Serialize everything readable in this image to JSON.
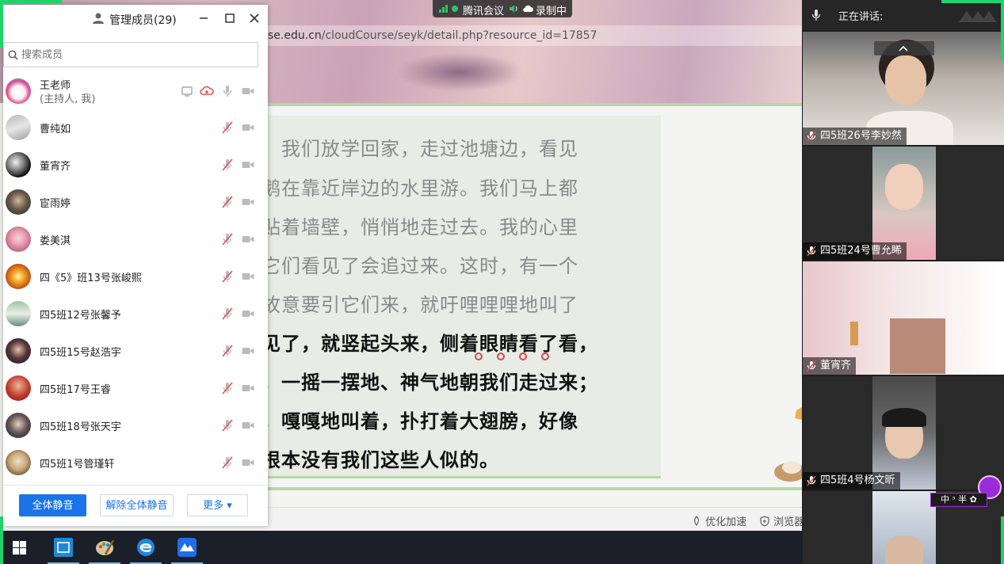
{
  "screen": {
    "url_prefix": "se.edu.cn",
    "url_rest": "/cloudCourse/seyk/detail.php?resource_id=17857",
    "text_lines_gray": [
      "，我们放学回家，走过池塘边，看见",
      "鹅在靠近岸边的水里游。我们马上都",
      "贴着墙壁，悄悄地走过去。我的心里",
      "它们看见了会追过来。这时，有一个",
      "故意要引它们来，就吁哩哩哩地叫了"
    ],
    "text_lines_dark": [
      "见了，就竖起头来，侧着眼睛看了看，",
      "，一摇一摆地、神气地朝我们走过来；",
      "，嘎嘎地叫着，扑打着大翅膀，好像",
      "根本没有我们这些人似的。"
    ],
    "bottom_items": [
      "优化加速",
      "浏览器"
    ]
  },
  "meeting_bar": {
    "app_name": "腾讯会议",
    "recording": "录制中"
  },
  "panel": {
    "title": "管理成员(29)",
    "search_placeholder": "搜索成员",
    "host": {
      "name": "王老师",
      "role": "(主持人, 我)"
    },
    "members": [
      "曹纯如",
      "董宵齐",
      "宦雨婷",
      "娄美淇",
      "四《5》班13号张峻熙",
      "四5班12号张馨予",
      "四5班15号赵浩宇",
      "四5班17号王睿",
      "四5班18号张天宇",
      "四5班1号管瑾轩"
    ],
    "footer": {
      "mute_all": "全体静音",
      "unmute_all": "解除全体静音",
      "more": "更多 ▾"
    }
  },
  "videos": {
    "speaking_label": "正在讲话:",
    "tiles": [
      "四5班26号李妙然",
      "四5班24号曹允睎",
      "董宵齐",
      "四5班4号杨文昕"
    ],
    "badge": "中 ᵌ 半 ✿"
  },
  "colors": {
    "accent_blue": "#1a73e8",
    "mute_red": "#e05050",
    "text_green_line": "#b7d8a5"
  }
}
